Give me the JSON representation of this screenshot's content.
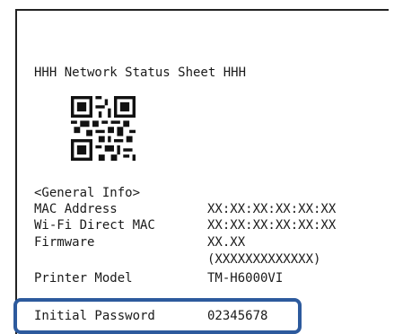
{
  "sheet": {
    "title": "HHH Network Status Sheet HHH",
    "section_header": "<General Info>",
    "rows": [
      {
        "label": "MAC Address",
        "value": "XX:XX:XX:XX:XX:XX"
      },
      {
        "label": "Wi-Fi Direct MAC",
        "value": "XX:XX:XX:XX:XX:XX"
      },
      {
        "label": "Firmware",
        "value": "XX.XX"
      },
      {
        "label": "",
        "value": "(XXXXXXXXXXXXX)"
      },
      {
        "label": "Printer Model",
        "value": "TM-H6000VI"
      },
      {
        "label": "Initial Password",
        "value": "02345678"
      }
    ]
  },
  "colors": {
    "callout_border": "#2d5a9d"
  },
  "icons": {
    "qr": "qr-code-icon"
  }
}
